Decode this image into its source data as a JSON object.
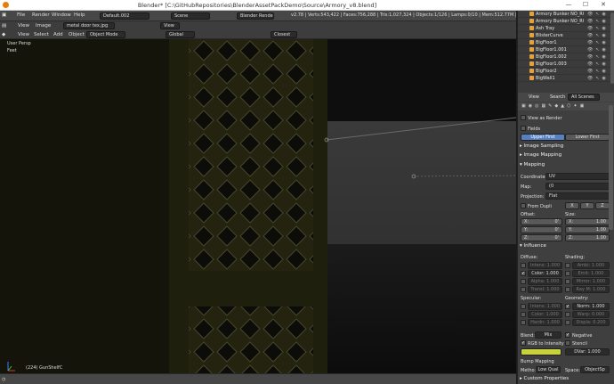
{
  "window": {
    "title": "Blender* [C:\\GitHubRepositories\\BlenderAssetPackDemo\\Source\\Armory_v8.blend]",
    "min": "—",
    "max": "☐",
    "close": "✕"
  },
  "topbar": {
    "menus": [
      "File",
      "Render",
      "Window",
      "Help"
    ],
    "layout": "Default.002",
    "scene": "Scene",
    "engine": "Blender Render",
    "stats": "v2.78 | Verts:543,422 | Faces:756,288 | Tris:1,027,324 | Objects:1/126 | Lamps:0/10 | Mem:512.77M | GunShelfC"
  },
  "image_editor": {
    "menus": [
      "View",
      "Image"
    ],
    "image_name": "metal door tex.jpg",
    "view": "View"
  },
  "viewport_header": {
    "menus": [
      "View",
      "Select",
      "Add",
      "Object"
    ],
    "mode": "Object Mode",
    "orientation": "Global",
    "snap": "Closest"
  },
  "viewport": {
    "persp": "User Persp",
    "units": "Feet",
    "object_info": "(224) GunShelfC"
  },
  "outliner": {
    "items": [
      "Armory Bunker NO_ROOM",
      "Armory Bunker NO_ROOM",
      "Ash Tray",
      "BlisterCurve",
      "BigFloor1",
      "BigFloor1.001",
      "BigFloor1.002",
      "BigFloor1.003",
      "BigFloor2",
      "BigWall1"
    ]
  },
  "properties": {
    "tabs": {
      "view": "View",
      "search": "Search",
      "scenes": "All Scenes"
    },
    "view_as_render": "View as Render",
    "fields": "Fields",
    "upper_first": "Upper First",
    "lower_first": "Lower First",
    "image_sampling": "Image Sampling",
    "image_mapping": "Image Mapping",
    "mapping": "Mapping",
    "coordinates_label": "Coordinates:",
    "coordinates": "UV",
    "map_label": "Map:",
    "map": "(0",
    "projection_label": "Projection:",
    "projection": "Flat",
    "from_dupli": "From Dupli",
    "xyz": [
      "X",
      "Y",
      "Z"
    ],
    "offset_label": "Offset:",
    "size_label": "Size:",
    "offset": [
      {
        "a": "X:",
        "v": "0'"
      },
      {
        "a": "Y:",
        "v": "0'"
      },
      {
        "a": "Z:",
        "v": "0'"
      }
    ],
    "size": [
      {
        "a": "X:",
        "v": "1.00"
      },
      {
        "a": "Y:",
        "v": "1.00"
      },
      {
        "a": "Z:",
        "v": "1.00"
      }
    ],
    "influence": "Influence",
    "diffuse_label": "Diffuse:",
    "shading_label": "Shading:",
    "diffuse": [
      {
        "l": "Intens:",
        "v": "1.000",
        "on": false
      },
      {
        "l": "Color:",
        "v": "1.000",
        "on": true
      },
      {
        "l": "Alpha:",
        "v": "1.000",
        "on": false
      },
      {
        "l": "Transl:",
        "v": "1.000",
        "on": false
      }
    ],
    "shading": [
      {
        "l": "Ambi:",
        "v": "1.000"
      },
      {
        "l": "Emit:",
        "v": "1.000"
      },
      {
        "l": "Mirror:",
        "v": "1.000"
      },
      {
        "l": "Ray M:",
        "v": "1.000"
      }
    ],
    "specular_label": "Specular:",
    "geometry_label": "Geometry:",
    "specular": [
      {
        "l": "Intens:",
        "v": "1.000"
      },
      {
        "l": "Color:",
        "v": "1.000"
      },
      {
        "l": "Hardn:",
        "v": "1.000"
      }
    ],
    "geometry": [
      {
        "l": "Norm:",
        "v": "1.000",
        "on": true
      },
      {
        "l": "Warp:",
        "v": "0.000",
        "on": false
      },
      {
        "l": "Displa:",
        "v": "0.200",
        "on": false
      }
    ],
    "blend_label": "Blend:",
    "blend": "Mix",
    "negative": "Negative",
    "rgb_to_intensity": "RGB to Intensity",
    "stencil": "Stencil",
    "dvar_label": "DVar:",
    "dvar": "1.000",
    "bump_mapping": "Bump Mapping",
    "method_label": "Metho:",
    "method": "Low Qual",
    "space_label": "Space:",
    "space": "ObjectSp",
    "custom_properties": "Custom Properties"
  },
  "colors": {
    "accent_blue": "#5680c2",
    "object_orange": "#e8a13a",
    "color_swatch": "#c8d23c"
  }
}
